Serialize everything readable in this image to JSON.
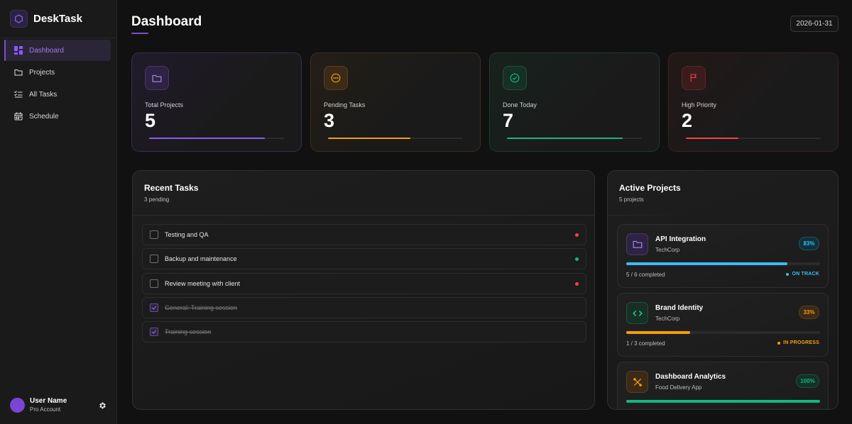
{
  "app": {
    "name": "DeskTask"
  },
  "sidebar": {
    "items": [
      {
        "label": "Dashboard",
        "icon": "dashboard-grid-icon",
        "active": true
      },
      {
        "label": "Projects",
        "icon": "folder-icon"
      },
      {
        "label": "All Tasks",
        "icon": "checklist-icon"
      },
      {
        "label": "Schedule",
        "icon": "calendar-icon"
      }
    ],
    "user": {
      "name": "User Name",
      "plan": "Pro Account"
    }
  },
  "header": {
    "title": "Dashboard",
    "date": "2026-01-31"
  },
  "stats": [
    {
      "label": "Total Projects",
      "value": "5",
      "progress": 0.86,
      "color": "#8b5cf6",
      "icon": "folder-icon"
    },
    {
      "label": "Pending Tasks",
      "value": "3",
      "progress": 0.61,
      "color": "#f59e0b",
      "icon": "clock-dots-icon"
    },
    {
      "label": "Done Today",
      "value": "7",
      "progress": 0.86,
      "color": "#10b981",
      "icon": "check-circle-icon"
    },
    {
      "label": "High Priority",
      "value": "2",
      "progress": 0.39,
      "color": "#ef4444",
      "icon": "flag-icon"
    }
  ],
  "recent_tasks": {
    "title": "Recent Tasks",
    "subtitle": "3 pending",
    "items": [
      {
        "text": "Testing and QA",
        "done": false,
        "priority_color": "#ef4444"
      },
      {
        "text": "Backup and maintenance",
        "done": false,
        "priority_color": "#10b981"
      },
      {
        "text": "Review meeting with client",
        "done": false,
        "priority_color": "#ef4444"
      },
      {
        "text": "General: Training session",
        "done": true
      },
      {
        "text": "Training session",
        "done": true
      }
    ]
  },
  "active_projects": {
    "title": "Active Projects",
    "subtitle": "5 projects",
    "items": [
      {
        "name": "API Integration",
        "client": "TechCorp",
        "percent_label": "83%",
        "progress": 0.83,
        "count": "5 / 6 completed",
        "status": "ON TRACK",
        "color": "#38bdf8",
        "icon": "folder-icon",
        "icon_color": "#a78bfa"
      },
      {
        "name": "Brand Identity",
        "client": "TechCorp",
        "percent_label": "33%",
        "progress": 0.33,
        "count": "1 / 3 completed",
        "status": "IN PROGRESS",
        "color": "#f59e0b",
        "icon": "code-brackets-icon",
        "icon_color": "#34d399"
      },
      {
        "name": "Dashboard Analytics",
        "client": "Food Delivery App",
        "percent_label": "100%",
        "progress": 1.0,
        "color": "#10b981",
        "icon": "tools-icon",
        "icon_color": "#f59e0b"
      }
    ]
  }
}
